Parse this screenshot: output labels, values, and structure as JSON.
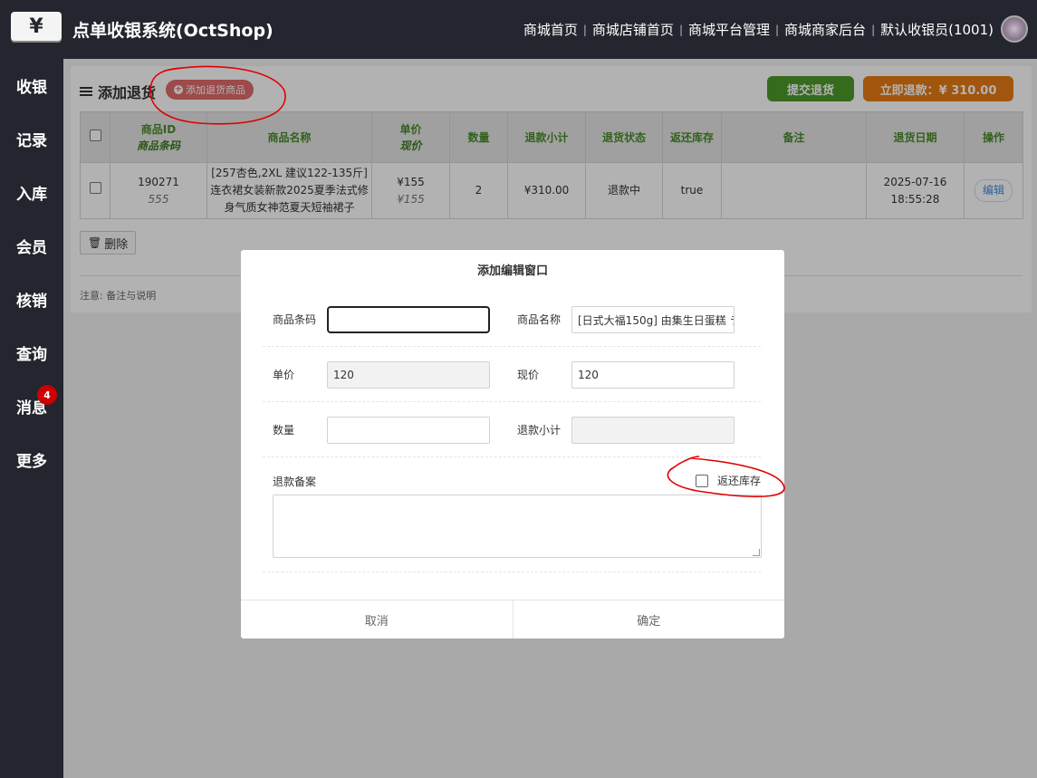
{
  "header": {
    "logo_symbol": "¥",
    "title": "点单收银系统(OctShop)",
    "nav": [
      "商城首页",
      "商城店铺首页",
      "商城平台管理",
      "商城商家后台",
      "默认收银员(1001)"
    ],
    "separator": "|"
  },
  "sidebar": {
    "items": [
      {
        "label": "收银"
      },
      {
        "label": "记录"
      },
      {
        "label": "入库"
      },
      {
        "label": "会员"
      },
      {
        "label": "核销"
      },
      {
        "label": "查询"
      },
      {
        "label": "消息",
        "badge": "4"
      },
      {
        "label": "更多"
      }
    ]
  },
  "panel": {
    "title": "添加退货",
    "add_button": "添加退货商品",
    "submit_button": "提交退货",
    "refund_button": "立即退款：¥ 310.00",
    "delete_button": "删除",
    "note": "注意: 备注与说明"
  },
  "table": {
    "headers": {
      "id": "商品ID",
      "barcode": "商品条码",
      "name": "商品名称",
      "unit_price": "单价",
      "current_price": "现价",
      "qty": "数量",
      "subtotal": "退款小计",
      "status": "退货状态",
      "restock": "返还库存",
      "remark": "备注",
      "date": "退货日期",
      "action": "操作"
    },
    "rows": [
      {
        "id": "190271",
        "barcode": "555",
        "name": "[257杏色,2XL 建议122-135斤] 连衣裙女装新款2025夏季法式修身气质女神范夏天短袖裙子",
        "unit_price": "¥155",
        "current_price": "¥155",
        "qty": "2",
        "subtotal": "¥310.00",
        "status": "退款中",
        "restock": "true",
        "remark": "",
        "date": "2025-07-16 18:55:28",
        "action": "编辑"
      }
    ]
  },
  "modal": {
    "title": "添加编辑窗口",
    "fields": {
      "barcode_label": "商品条码",
      "barcode_value": "",
      "name_label": "商品名称",
      "name_value": "[日式大福150g] 由集生日蛋糕 ラ",
      "unit_price_label": "单价",
      "unit_price_value": "120",
      "current_price_label": "现价",
      "current_price_value": "120",
      "qty_label": "数量",
      "qty_value": "",
      "subtotal_label": "退款小计",
      "subtotal_value": "",
      "remark_label": "退款备案",
      "restock_label": "返还库存"
    },
    "cancel": "取消",
    "confirm": "确定"
  },
  "colors": {
    "header_bg": "#23262e",
    "submit_green": "#4e9a2a",
    "refund_orange": "#e87a14",
    "badge_red": "#cc0000",
    "table_header_text": "#4a8c2a",
    "annotation_ink": "#e00000"
  }
}
